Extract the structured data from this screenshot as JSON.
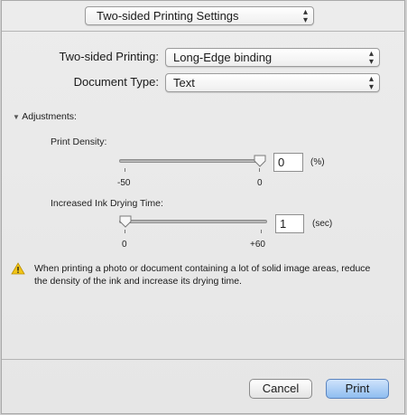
{
  "header": {
    "settings_popup": "Two-sided Printing Settings"
  },
  "two_sided": {
    "label": "Two-sided Printing:",
    "value": "Long-Edge binding"
  },
  "document_type": {
    "label": "Document Type:",
    "value": "Text"
  },
  "adjustments": {
    "label": "Adjustments:",
    "print_density": {
      "label": "Print Density:",
      "value": "0",
      "unit": "(%)",
      "min_label": "-50",
      "max_label": "0",
      "slider_level": 1.0
    },
    "drying_time": {
      "label": "Increased Ink Drying Time:",
      "value": "1",
      "unit": "(sec)",
      "min_label": "0",
      "max_label": "+60",
      "slider_level": 0.0
    }
  },
  "warning": {
    "text": "When printing a photo or document containing a lot of solid image areas, reduce the density of the ink and increase its drying time."
  },
  "buttons": {
    "cancel": "Cancel",
    "print": "Print"
  }
}
